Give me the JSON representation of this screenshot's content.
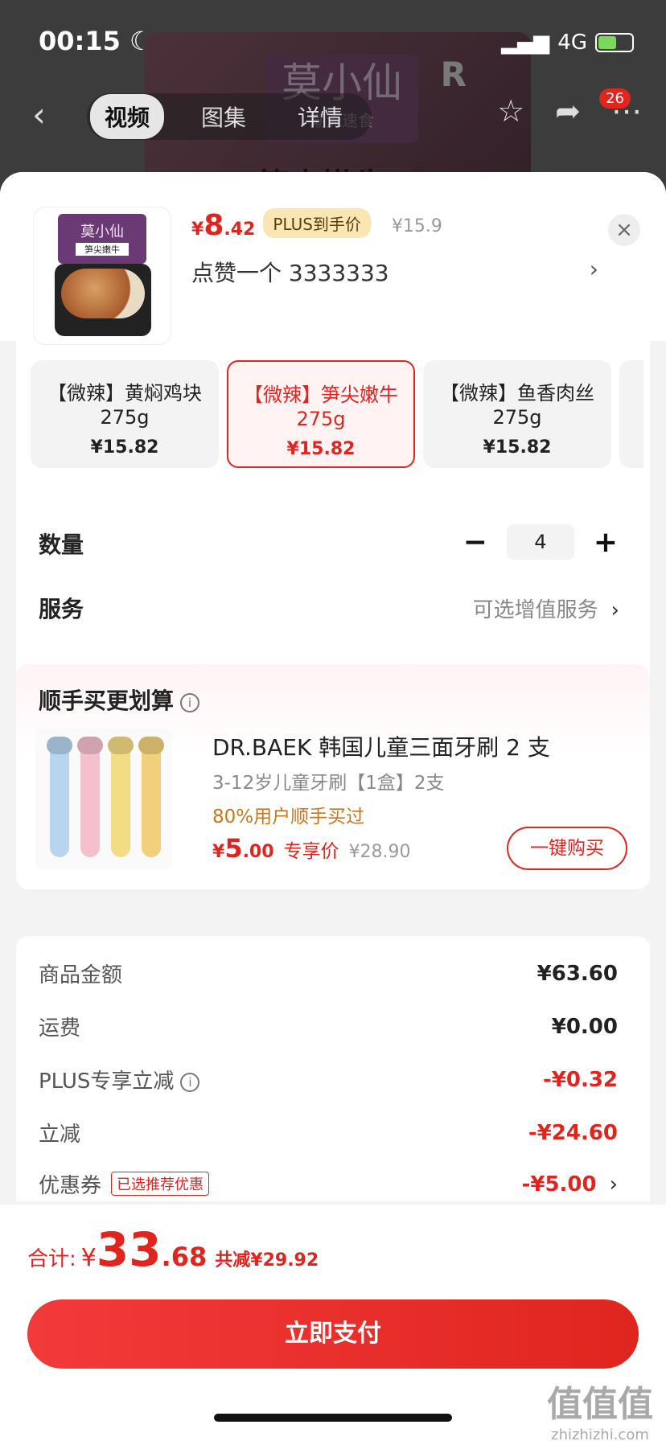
{
  "status_bar": {
    "time": "00:15",
    "moon": "☾",
    "network": "4G"
  },
  "nav": {
    "back": "‹",
    "tabs": [
      "视频",
      "图集",
      "详情"
    ],
    "badge_count": "26"
  },
  "background_product": {
    "brand": "莫小仙",
    "brand_sub": "潮流速食",
    "caption": "笋尖嫩牛",
    "r_mark": "R"
  },
  "sheet_header": {
    "price_symbol": "¥",
    "price_int": "8",
    "price_dec": ".42",
    "plus_tag": "PLUS到手价",
    "original_price": "¥15.9",
    "selected_spec": "点赞一个  3333333",
    "chevron": "›",
    "close": "×",
    "thumb_brand": "莫小仙",
    "thumb_label": "笋尖嫩牛"
  },
  "specs": [
    {
      "name": "【微辣】黄焖鸡块",
      "weight": "275g",
      "price": "¥15.82"
    },
    {
      "name": "【微辣】笋尖嫩牛",
      "weight": "275g",
      "price": "¥15.82",
      "selected": true
    },
    {
      "name": "【微辣】鱼香肉丝",
      "weight": "275g",
      "price": "¥15.82"
    }
  ],
  "quantity": {
    "label": "数量",
    "minus": "−",
    "value": "4",
    "plus": "+"
  },
  "service": {
    "label": "服务",
    "value": "可选增值服务",
    "chevron": "›"
  },
  "addon": {
    "title": "顺手买更划算",
    "info": "i",
    "name": "DR.BAEK 韩国儿童三面牙刷 2 支",
    "sub": "3-12岁儿童牙刷【1盒】2支",
    "note": "80%用户顺手买过",
    "price_symbol": "¥",
    "price_int": "5",
    "price_dec": ".00",
    "price_tag": "专享价",
    "original_price": "¥28.90",
    "buy_button": "一键购买"
  },
  "fees": [
    {
      "label": "商品金额",
      "value": "¥63.60"
    },
    {
      "label": "运费",
      "value": "¥0.00"
    },
    {
      "label": "PLUS专享立减",
      "value": "-¥0.32"
    },
    {
      "label": "立减",
      "value": "-¥24.60"
    },
    {
      "label": "优惠券",
      "tag": "已选推荐优惠",
      "value": "-¥5.00",
      "chevron": "›"
    }
  ],
  "footer": {
    "total_label": "合计:",
    "total_symbol": "¥",
    "total_int": "33",
    "total_dec": ".68",
    "saved": "共减¥29.92",
    "pay_button": "立即支付"
  },
  "watermark": {
    "text": "值值值",
    "url": "zhizhizhi.com"
  },
  "colors": {
    "accent": "#e0251f",
    "plus_tag_bg": "#f9e7b3",
    "note": "#c8771a"
  }
}
